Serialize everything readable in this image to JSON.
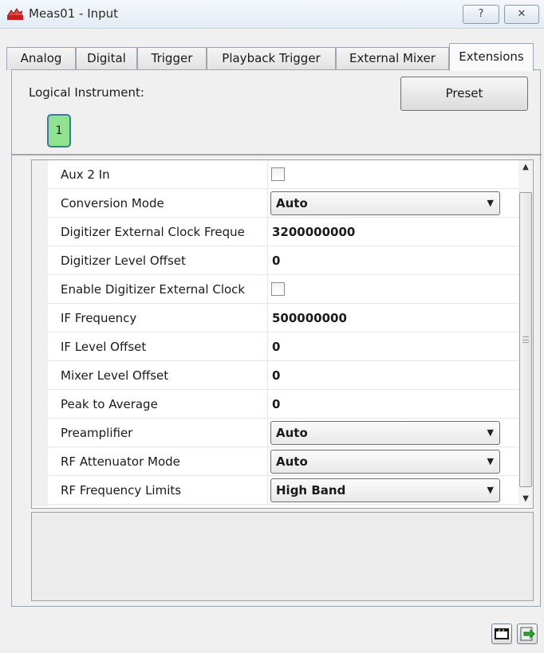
{
  "window": {
    "title": "Meas01 - Input",
    "help_glyph": "?",
    "close_glyph": "✕"
  },
  "tabs": [
    {
      "label": "Analog"
    },
    {
      "label": "Digital"
    },
    {
      "label": "Trigger"
    },
    {
      "label": "Playback Trigger"
    },
    {
      "label": "External Mixer"
    },
    {
      "label": "Extensions",
      "active": true
    }
  ],
  "header": {
    "logical_instrument_label": "Logical Instrument:",
    "preset_label": "Preset",
    "instrument_number": "1"
  },
  "properties": [
    {
      "name": "Aux 2 In",
      "type": "checkbox",
      "checked": false
    },
    {
      "name": "Conversion Mode",
      "type": "combo",
      "value": "Auto"
    },
    {
      "name": "Digitizer External Clock Freque",
      "type": "text",
      "value": "3200000000"
    },
    {
      "name": "Digitizer Level Offset",
      "type": "text",
      "value": "0"
    },
    {
      "name": "Enable Digitizer External Clock",
      "type": "checkbox",
      "checked": false
    },
    {
      "name": "IF Frequency",
      "type": "text",
      "value": "500000000"
    },
    {
      "name": "IF Level Offset",
      "type": "text",
      "value": "0"
    },
    {
      "name": "Mixer Level Offset",
      "type": "text",
      "value": "0"
    },
    {
      "name": "Peak to Average",
      "type": "text",
      "value": "0"
    },
    {
      "name": "Preamplifier",
      "type": "combo",
      "value": "Auto"
    },
    {
      "name": "RF Attenuator Mode",
      "type": "combo",
      "value": "Auto"
    },
    {
      "name": "RF Frequency Limits",
      "type": "combo",
      "value": "High Band"
    }
  ],
  "scrollbar": {
    "up_glyph": "▲",
    "down_glyph": "▼"
  },
  "icons": {
    "app": "instrument-app-icon",
    "bottom_left": "window-icon",
    "bottom_right": "export-icon"
  },
  "colors": {
    "instrument_button": "#8fe28f",
    "instrument_border": "#3b7a99"
  }
}
